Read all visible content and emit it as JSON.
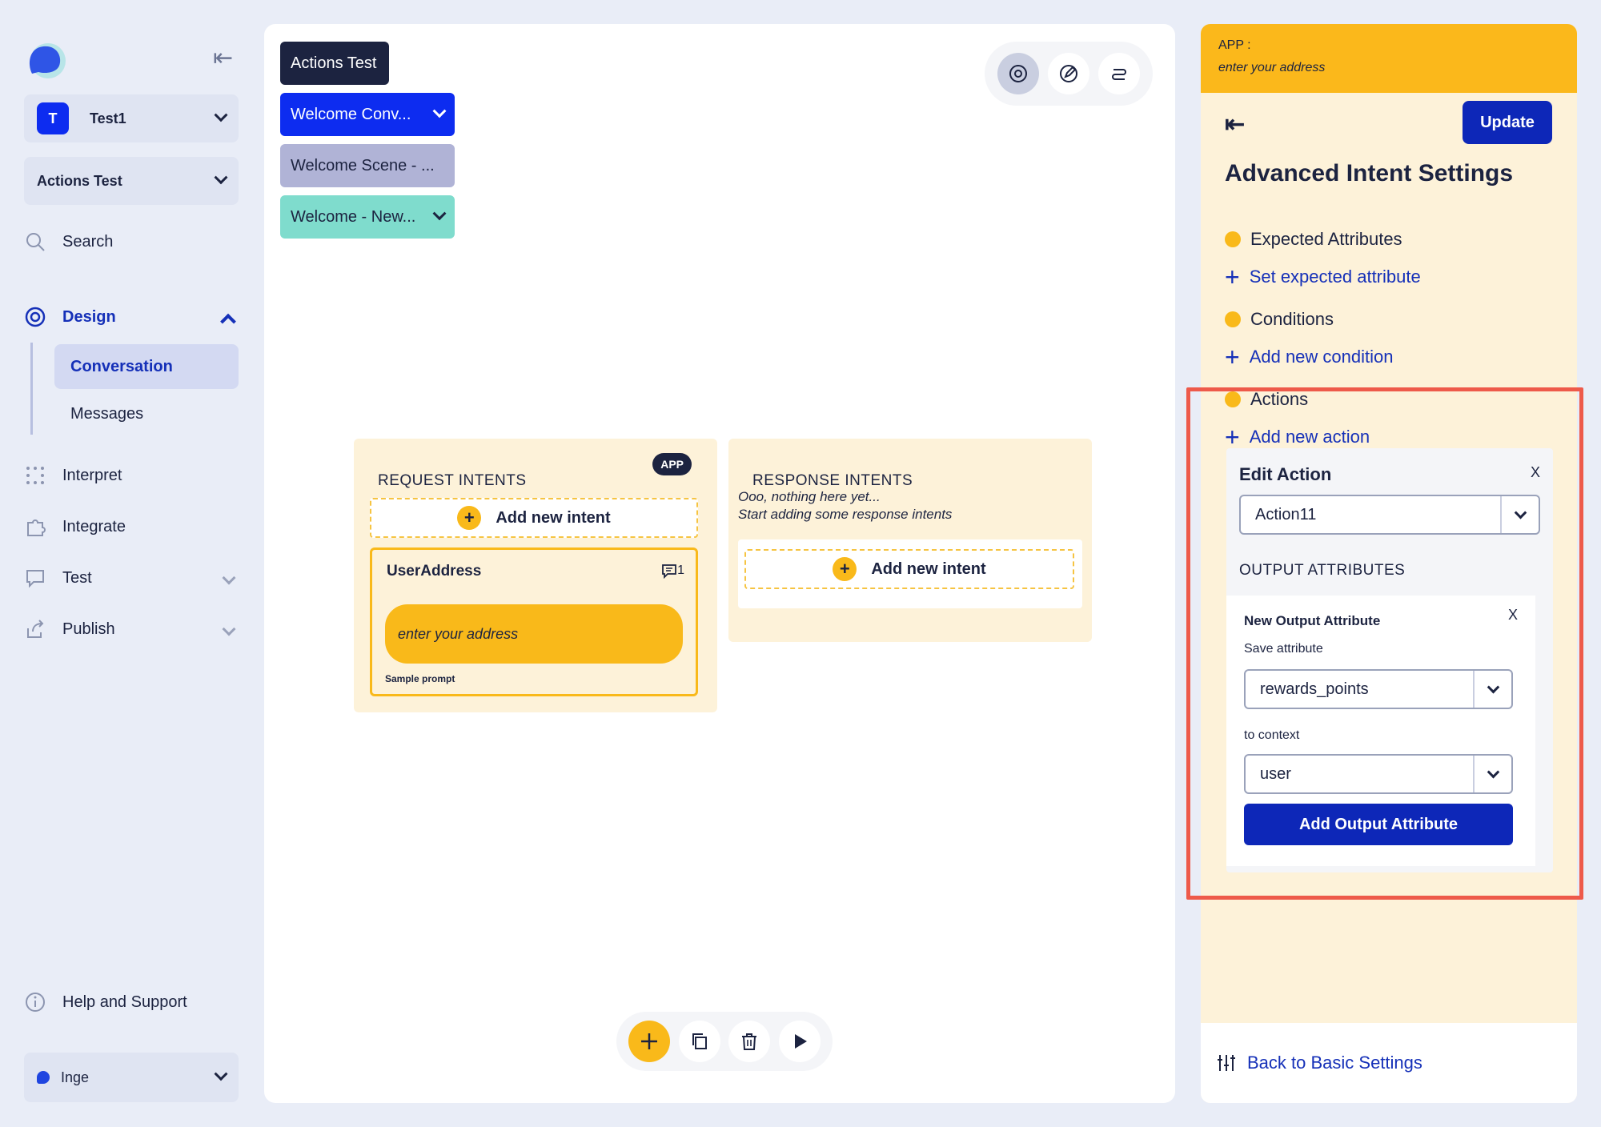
{
  "sidebar": {
    "workspace": {
      "initial": "T",
      "name": "Test1"
    },
    "project": "Actions Test",
    "search_label": "Search",
    "design_label": "Design",
    "subnav": [
      "Conversation",
      "Messages"
    ],
    "items": [
      "Interpret",
      "Integrate",
      "Test",
      "Publish"
    ],
    "help_label": "Help and Support",
    "user_name": "Inge"
  },
  "canvas": {
    "chips": [
      "Actions Test",
      "Welcome Conv...",
      "Welcome Scene - ...",
      "Welcome - New..."
    ],
    "request_panel": {
      "title": "REQUEST INTENTS",
      "badge": "APP",
      "add_intent": "Add new intent",
      "intent": {
        "name": "UserAddress",
        "count": "1",
        "prompt": "enter your address",
        "prompt_label": "Sample prompt"
      }
    },
    "response_panel": {
      "title": "RESPONSE INTENTS",
      "empty_line1": "Ooo, nothing here yet...",
      "empty_line2": "Start adding some response intents",
      "add_intent": "Add new intent"
    }
  },
  "right_panel": {
    "app_label": "APP :",
    "app_prompt": "enter your address",
    "update_label": "Update",
    "title": "Advanced Intent Settings",
    "expected_attributes": "Expected Attributes",
    "set_expected_attribute": "Set expected attribute",
    "conditions": "Conditions",
    "add_new_condition": "Add new condition",
    "actions": "Actions",
    "add_new_action": "Add new action",
    "edit_action": {
      "title": "Edit Action",
      "close": "X",
      "selected_action": "Action11",
      "output_title": "OUTPUT ATTRIBUTES",
      "new_output": {
        "title": "New Output Attribute",
        "close": "X",
        "save_attribute_label": "Save attribute",
        "save_attribute_value": "rewards_points",
        "to_context_label": "to context",
        "to_context_value": "user",
        "add_button": "Add Output Attribute"
      }
    },
    "back_to_basic": "Back to Basic Settings"
  },
  "colors": {
    "accent_blue": "#0d27b8",
    "accent_yellow": "#f9b91a",
    "highlight_red": "#ee5a4a",
    "chip_blue": "#0d2cf0",
    "chip_gray": "#b0b3d6",
    "chip_teal": "#7fdccd"
  }
}
